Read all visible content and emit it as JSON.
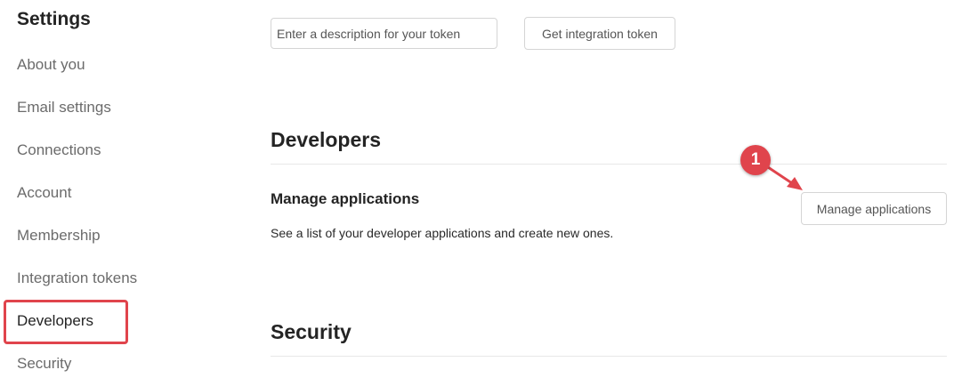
{
  "sidebar": {
    "title": "Settings",
    "items": [
      {
        "label": "About you"
      },
      {
        "label": "Email settings"
      },
      {
        "label": "Connections"
      },
      {
        "label": "Account"
      },
      {
        "label": "Membership"
      },
      {
        "label": "Integration tokens"
      },
      {
        "label": "Developers",
        "active": true
      },
      {
        "label": "Security"
      }
    ]
  },
  "tokens": {
    "input_placeholder": "Enter a description for your token",
    "button_label": "Get integration token"
  },
  "developers": {
    "title": "Developers",
    "manage": {
      "title": "Manage applications",
      "description": "See a list of your developer applications and create new ones.",
      "button_label": "Manage applications"
    }
  },
  "security": {
    "title": "Security"
  },
  "annotation": {
    "step_number": "1",
    "color": "#e0444c"
  }
}
